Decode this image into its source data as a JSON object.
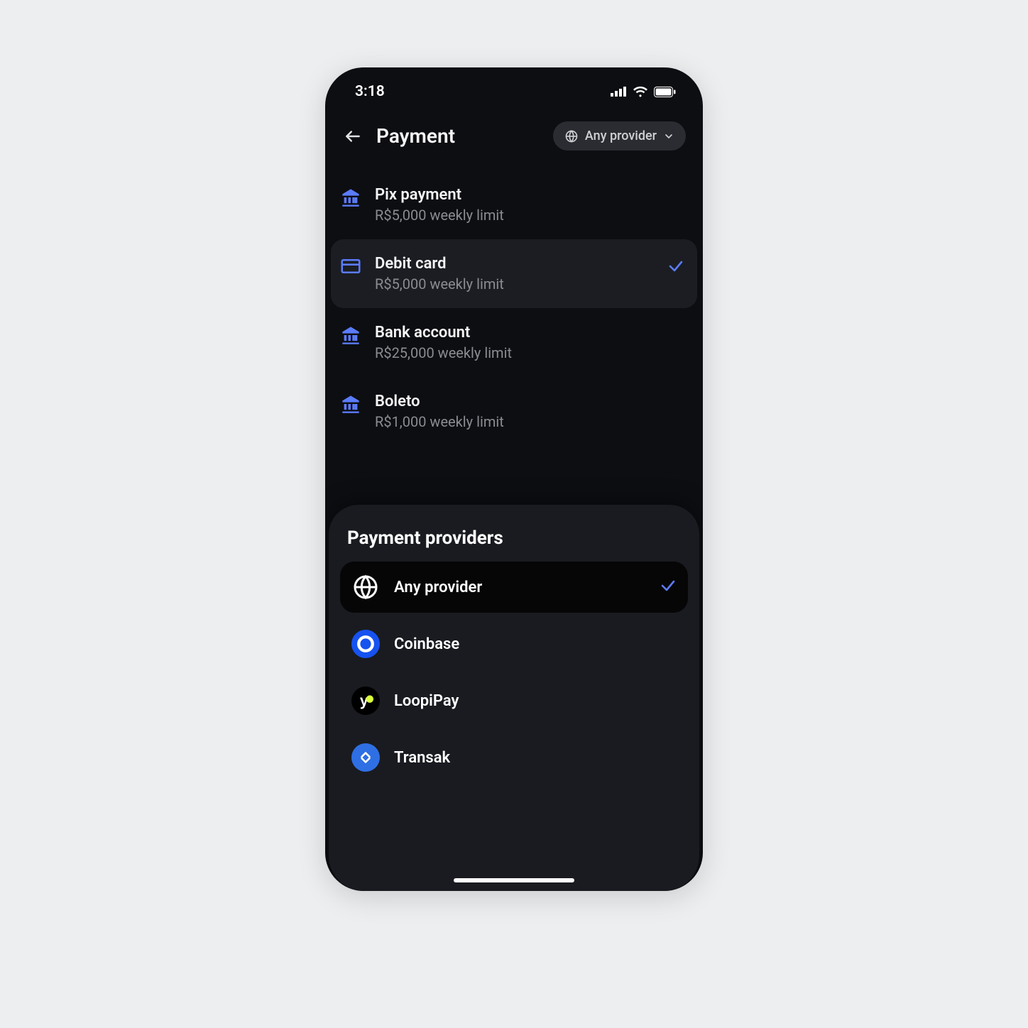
{
  "status": {
    "time": "3:18"
  },
  "header": {
    "title": "Payment",
    "pill_label": "Any provider"
  },
  "methods": [
    {
      "key": "pix",
      "title": "Pix payment",
      "sub": "R$5,000 weekly limit",
      "selected": false,
      "icon": "bank"
    },
    {
      "key": "debit",
      "title": "Debit card",
      "sub": "R$5,000 weekly limit",
      "selected": true,
      "icon": "card"
    },
    {
      "key": "bank",
      "title": "Bank account",
      "sub": "R$25,000 weekly limit",
      "selected": false,
      "icon": "bank"
    },
    {
      "key": "boleto",
      "title": "Boleto",
      "sub": "R$1,000 weekly limit",
      "selected": false,
      "icon": "bank"
    }
  ],
  "sheet": {
    "title": "Payment providers",
    "providers": [
      {
        "key": "any",
        "label": "Any provider",
        "selected": true,
        "icon": "globe"
      },
      {
        "key": "coinbase",
        "label": "Coinbase",
        "selected": false,
        "icon": "coinbase"
      },
      {
        "key": "loopipay",
        "label": "LoopiPay",
        "selected": false,
        "icon": "loopipay"
      },
      {
        "key": "transak",
        "label": "Transak",
        "selected": false,
        "icon": "transak"
      }
    ]
  },
  "colors": {
    "accent": "#5b7cfa"
  }
}
